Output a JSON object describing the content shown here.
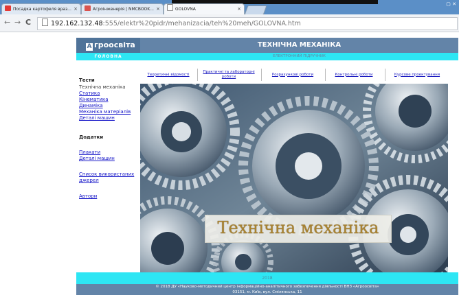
{
  "browser": {
    "tabs": [
      {
        "title": "Посадка картофеля враз...",
        "fav_color": "#e53935"
      },
      {
        "title": "Агроінженерія | NMCBOOK...",
        "fav_color": "#d9534f"
      },
      {
        "title": "GOLOVNA",
        "fav_color": "#9aa"
      }
    ],
    "url_host": "192.162.132.48",
    "url_rest": ":555/elektr%20pidr/mehanizacia/teh%20meh/GOLOVNA.htm"
  },
  "site": {
    "logo_letter": "А",
    "logo_text": "гроосвіта",
    "title": "ТЕХНІЧНА МЕХАНІКА",
    "home": "ГОЛОВНА",
    "subtitle": "ЕЛЕКТРОННИЙ ПІДРУЧНИК"
  },
  "sidebar": {
    "tests_heading": "Тести",
    "tests_sub": "Технічна механіка",
    "tests_links": [
      "Статика",
      "Кінематика",
      "Динаміка",
      "Механіка матеріалів",
      "Деталі машин"
    ],
    "extras_heading": "Додатки",
    "extras_links": [
      "Плакати",
      "Деталі машин"
    ],
    "sources_line1": "Список використаних",
    "sources_line2": "джерел",
    "authors": "Автори"
  },
  "nav": [
    "Теоретичні відомості",
    "Практичні та лабораторні роботи",
    "Розрахункові роботи",
    "Контрольні роботи",
    "Курсове проектування"
  ],
  "banner_text": "Технічна механіка",
  "footer": {
    "year": "2018",
    "copyright": "© 2018 ДУ «Науково-методичний центр інформаційно-аналітичного забезпечення діяльності ВНЗ «Агроосвіта»",
    "address": "03151, м. Київ, вул. Смілянська, 11"
  },
  "colors": {
    "header_bg": "#6384a8",
    "accent_cyan": "#2de6f4",
    "link": "#1515c8"
  }
}
